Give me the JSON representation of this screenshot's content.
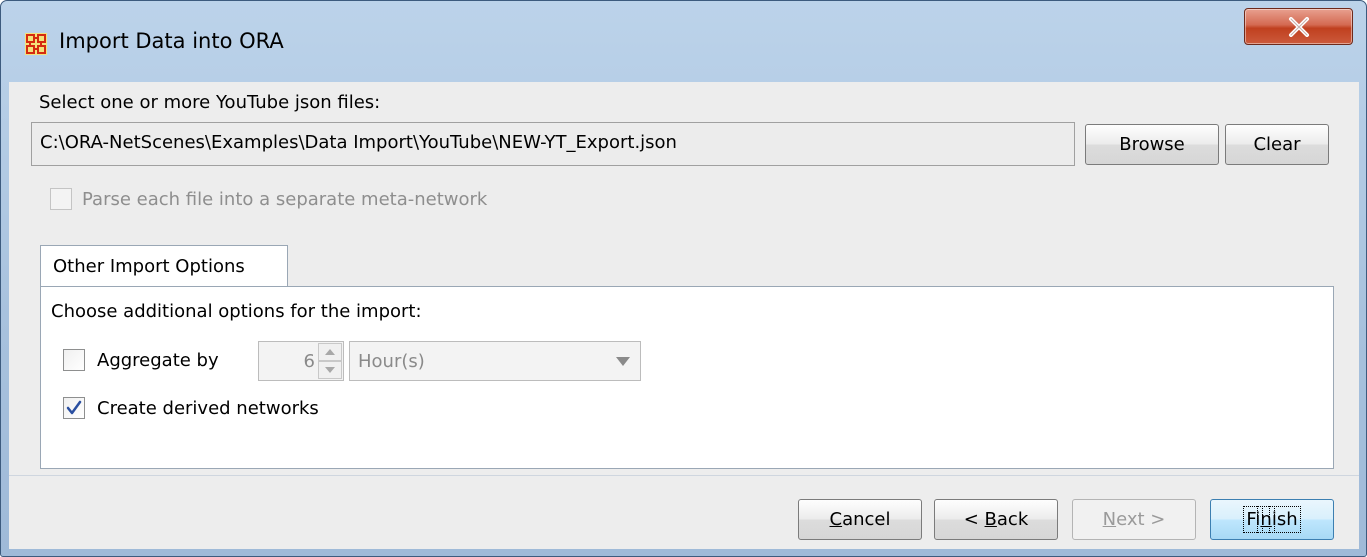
{
  "window": {
    "title": "Import Data into ORA",
    "close_label": "X"
  },
  "file_section": {
    "label": "Select one or more YouTube json files:",
    "path_value": "C:\\ORA-NetScenes\\Examples\\Data Import\\YouTube\\NEW-YT_Export.json",
    "browse_label": "Browse",
    "clear_label": "Clear",
    "parse_separate_label": "Parse each file into a separate meta-network",
    "parse_separate_checked": false,
    "parse_separate_enabled": false
  },
  "options_tab": {
    "tab_label": "Other Import Options",
    "instruction": "Choose additional options for the import:",
    "aggregate_label": "Aggregate by",
    "aggregate_checked": false,
    "aggregate_amount": "6",
    "aggregate_unit": "Hour(s)",
    "derived_label": "Create derived networks",
    "derived_checked": true
  },
  "footer": {
    "cancel_prefix": "",
    "cancel_mnemonic": "C",
    "cancel_suffix": "ancel",
    "back_prefix": "< ",
    "back_mnemonic": "B",
    "back_suffix": "ack",
    "next_prefix": "",
    "next_mnemonic": "N",
    "next_suffix": "ext >",
    "finish_prefix": "Fi",
    "finish_mnemonic": "n",
    "finish_suffix": "ish"
  },
  "colors": {
    "title_gradient": "#bcd3ea",
    "dialog_bg": "#ededed",
    "close_button": "#c0401f",
    "check_mark": "#2a4fa0",
    "app_icon": "#d62b10"
  },
  "icons": {
    "app": "ora-grid-icon",
    "close": "close-x-icon",
    "check": "checkmark-icon",
    "dropdown": "dropdown-arrow-icon",
    "spin": "spinner-arrows-icon"
  }
}
